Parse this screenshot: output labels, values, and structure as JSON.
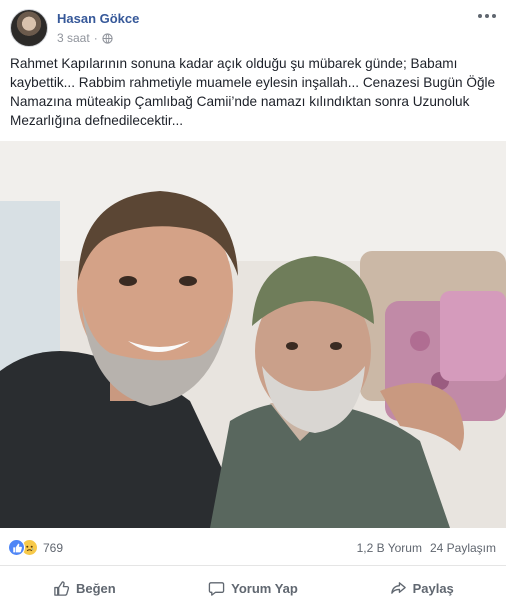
{
  "post": {
    "author": "Hasan Gökce",
    "timestamp": "3 saat",
    "separator": "·",
    "audience_icon": "globe-icon",
    "more_icon": "more-horizontal-icon",
    "text": "Rahmet Kapılarının sonuna kadar açık olduğu şu mübarek günde; Babamı kaybettik... Rabbim rahmetiyle muamele eylesin inşallah... Cenazesi Bugün Öğle Namazına müteakip Çamlıbağ Camii’nde namazı kılındıktan sonra Uzunoluk Mezarlığına defnedilecektir...",
    "photo_icon": "photo-selfie"
  },
  "stats": {
    "reactions": [
      "like-reaction-icon",
      "sad-reaction-icon"
    ],
    "reaction_count": "769",
    "comments": "1,2 B Yorum",
    "shares": "24 Paylaşım"
  },
  "actions": {
    "like": "Beğen",
    "comment": "Yorum Yap",
    "share": "Paylaş"
  },
  "colors": {
    "author": "#365899",
    "like_blue": "#4f86f6",
    "sad_yellow": "#f7c94a",
    "muted": "#606770"
  }
}
